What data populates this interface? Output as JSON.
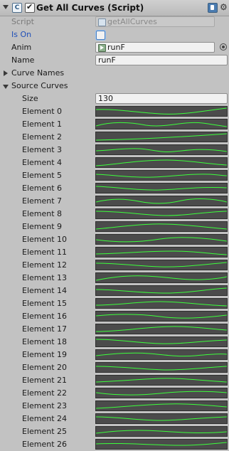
{
  "component": {
    "title": "Get All Curves (Script)",
    "enabled": true
  },
  "fields": {
    "script": {
      "label": "Script",
      "value": "getAllCurves"
    },
    "is_on": {
      "label": "Is On",
      "checked": false
    },
    "anim": {
      "label": "Anim",
      "value": "runF"
    },
    "name": {
      "label": "Name",
      "value": "runF"
    },
    "curve_names": {
      "label": "Curve Names",
      "expanded": false
    },
    "source_curves": {
      "label": "Source Curves",
      "expanded": true,
      "size_label": "Size",
      "size_value": "130"
    }
  },
  "elements": [
    {
      "label": "Element 0"
    },
    {
      "label": "Element 1"
    },
    {
      "label": "Element 2"
    },
    {
      "label": "Element 3"
    },
    {
      "label": "Element 4"
    },
    {
      "label": "Element 5"
    },
    {
      "label": "Element 6"
    },
    {
      "label": "Element 7"
    },
    {
      "label": "Element 8"
    },
    {
      "label": "Element 9"
    },
    {
      "label": "Element 10"
    },
    {
      "label": "Element 11"
    },
    {
      "label": "Element 12"
    },
    {
      "label": "Element 13"
    },
    {
      "label": "Element 14"
    },
    {
      "label": "Element 15"
    },
    {
      "label": "Element 16"
    },
    {
      "label": "Element 17"
    },
    {
      "label": "Element 18"
    },
    {
      "label": "Element 19"
    },
    {
      "label": "Element 20"
    },
    {
      "label": "Element 21"
    },
    {
      "label": "Element 22"
    },
    {
      "label": "Element 23"
    },
    {
      "label": "Element 24"
    },
    {
      "label": "Element 25"
    },
    {
      "label": "Element 26"
    }
  ],
  "colors": {
    "curve_stroke": "#3cff3c",
    "curve_bg": "#4b4b4b",
    "inspector_bg": "#c2c2c2",
    "is_on_label": "#1f4fb8"
  },
  "icons": [
    "fold-triangle-icon",
    "script-icon",
    "checkbox-icon",
    "help-book-icon",
    "gear-icon",
    "animation-clip-icon",
    "object-picker-icon"
  ]
}
